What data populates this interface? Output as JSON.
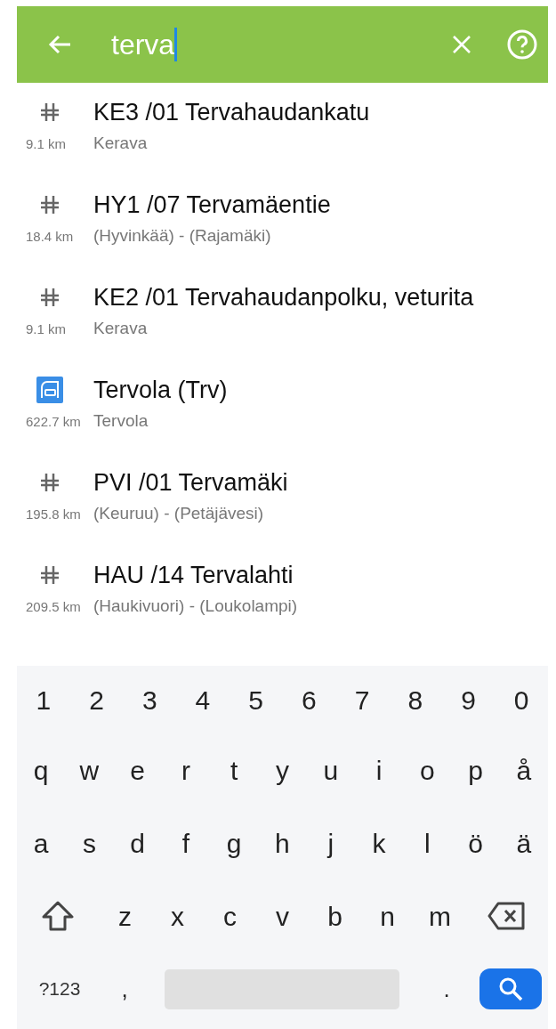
{
  "search": {
    "value": "terva"
  },
  "results": [
    {
      "kind": "stop",
      "title": "KE3 /01 Tervahaudankatu",
      "distance": "9.1 km",
      "subtitle": "Kerava"
    },
    {
      "kind": "stop",
      "title": "HY1 /07 Tervamäentie",
      "distance": "18.4 km",
      "subtitle": "(Hyvinkää) - (Rajamäki)"
    },
    {
      "kind": "stop",
      "title": "KE2 /01 Tervahaudanpolku, veturita",
      "distance": "9.1 km",
      "subtitle": "Kerava"
    },
    {
      "kind": "station",
      "title": "Tervola (Trv)",
      "distance": "622.7 km",
      "subtitle": "Tervola"
    },
    {
      "kind": "stop",
      "title": "PVI /01 Tervamäki",
      "distance": "195.8 km",
      "subtitle": "(Keuruu) - (Petäjävesi)"
    },
    {
      "kind": "stop",
      "title": "HAU /14 Tervalahti",
      "distance": "209.5 km",
      "subtitle": "(Haukivuori) - (Loukolampi)"
    }
  ],
  "keyboard": {
    "number_row": [
      "1",
      "2",
      "3",
      "4",
      "5",
      "6",
      "7",
      "8",
      "9",
      "0"
    ],
    "letter_rows": [
      [
        "q",
        "w",
        "e",
        "r",
        "t",
        "y",
        "u",
        "i",
        "o",
        "p",
        "å"
      ],
      [
        "a",
        "s",
        "d",
        "f",
        "g",
        "h",
        "j",
        "k",
        "l",
        "ö",
        "ä"
      ],
      [
        "z",
        "x",
        "c",
        "v",
        "b",
        "n",
        "m"
      ]
    ],
    "symbols_key": "?123",
    "comma": ",",
    "period": "."
  }
}
